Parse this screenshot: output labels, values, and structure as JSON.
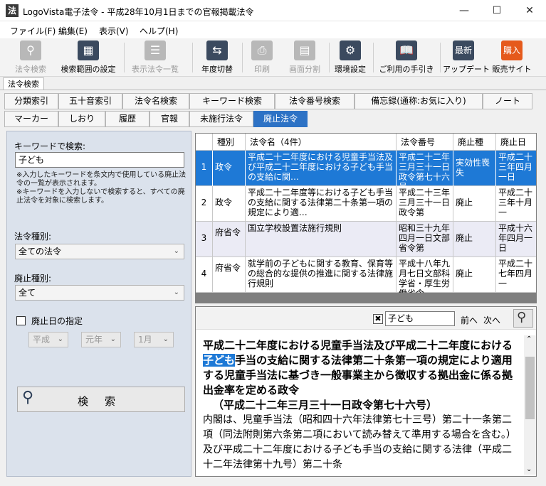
{
  "window": {
    "app_icon": "法",
    "title": "LogoVista電子法令 - 平成28年10月1日までの官報掲載法令",
    "controls": {
      "minimize": "—",
      "maximize": "☐",
      "close": "✕"
    }
  },
  "menu": [
    {
      "label": "ファイル(F)"
    },
    {
      "label": "編集(E)"
    },
    {
      "label": "表示(V)"
    },
    {
      "label": "ヘルプ(H)"
    }
  ],
  "toolbar": [
    {
      "label": "法令検索",
      "icon": "search-icon",
      "enabled": false
    },
    {
      "label": "検索範囲の設定",
      "icon": "search-range-icon",
      "enabled": true
    },
    {
      "label": "表示法令一覧",
      "icon": "list-icon",
      "enabled": false
    },
    {
      "label": "年度切替",
      "icon": "switch-arrows-icon",
      "enabled": true
    },
    {
      "label": "印刷",
      "icon": "printer-icon",
      "enabled": false
    },
    {
      "label": "画面分割",
      "icon": "split-icon",
      "enabled": false
    },
    {
      "label": "環境設定",
      "icon": "gear-icon",
      "enabled": true
    },
    {
      "label": "ご利用の手引き",
      "icon": "book-icon",
      "enabled": true
    },
    {
      "label": "アップデート",
      "icon_text": "最新",
      "icon": "update-icon",
      "enabled": true
    },
    {
      "label": "販売サイト",
      "icon_text": "購入",
      "icon": "cart-icon",
      "enabled": true
    }
  ],
  "section_tab": "法令検索",
  "tabs_row1": [
    "分類索引",
    "五十音索引",
    "法令名検索",
    "キーワード検索",
    "法令番号検索",
    "備忘録(通称:お気に入り)",
    "ノート"
  ],
  "tabs_row2": [
    "マーカー",
    "しおり",
    "履歴",
    "官報",
    "未施行法令",
    "廃止法令"
  ],
  "active_tab": "廃止法令",
  "left_panel": {
    "keyword_label": "キーワードで検索:",
    "keyword_value": "子ども",
    "note1": "※入力したキーワードを条文内で使用している廃止法令の一覧が表示されます。",
    "note2": "※キーワードを入力しないで検索すると、すべての廃止法令を対象に検索します。",
    "law_type_label": "法令種別:",
    "law_type_value": "全ての法令",
    "repeal_type_label": "廃止種別:",
    "repeal_type_value": "全て",
    "date_check_label": "廃止日の指定",
    "era": "平成",
    "year": "元年",
    "month": "1月",
    "search_button": "検　索"
  },
  "results": {
    "headers": [
      "種別",
      "法令名（4件）",
      "法令番号",
      "廃止種",
      "廃止日"
    ],
    "rows": [
      {
        "num": "1",
        "type": "政令",
        "name": "平成二十二年度における児童手当法及び平成二十二年度における子ども手当の支給に関…",
        "number": "平成二十二年三月三十一日政令第七十六号",
        "repeal_type": "実効性喪失",
        "repeal_date": "平成二十三年四月一日"
      },
      {
        "num": "2",
        "type": "政令",
        "name": "平成二十二年度等における子ども手当の支給に関する法律第二十条第一項の規定により適…",
        "number": "平成二十三年三月三十一日政令第",
        "repeal_type": "廃止",
        "repeal_date": "平成二十三年十月一"
      },
      {
        "num": "3",
        "type": "府省令",
        "name": "国立学校設置法施行規則",
        "number": "昭和三十九年四月一日文部省令第",
        "repeal_type": "廃止",
        "repeal_date": "平成十六年四月一日"
      },
      {
        "num": "4",
        "type": "府省令",
        "name": "就学前の子どもに関する教育、保育等の総合的な提供の推進に関する法律施行規則",
        "number": "平成十八年九月七日文部科学省・厚生労働省令",
        "repeal_type": "廃止",
        "repeal_date": "平成二十七年四月一"
      }
    ]
  },
  "document": {
    "search_value": "子ども",
    "clear_icon": "✖",
    "prev_label": "前へ",
    "next_label": "次へ",
    "title_before": "平成二十二年度における児童手当法及び平成二十二年度における",
    "title_highlight": "子ども",
    "title_after": "手当の支給に関する法律第二十条第一項の規定により適用する児童手当法に基づき一般事業主から徴収する拠出金に係る拠出金率を定める政令",
    "subtitle": "（平成二十二年三月三十一日政令第七十六号）",
    "body": "内閣は、児童手当法（昭和四十六年法律第七十三号）第二十一条第二項（同法附則第六条第二項において読み替えて準用する場合を含む。）及び平成二十二年度における子ども手当の支給に関する法律（平成二十二年法律第十九号）第二十条"
  },
  "colors": {
    "accent": "#1e79d6",
    "active_tab": "#2d72c5",
    "left_panel_bg": "#dbe2ec",
    "buy_button": "#e55a1c",
    "update_button": "#3b4a5f"
  }
}
